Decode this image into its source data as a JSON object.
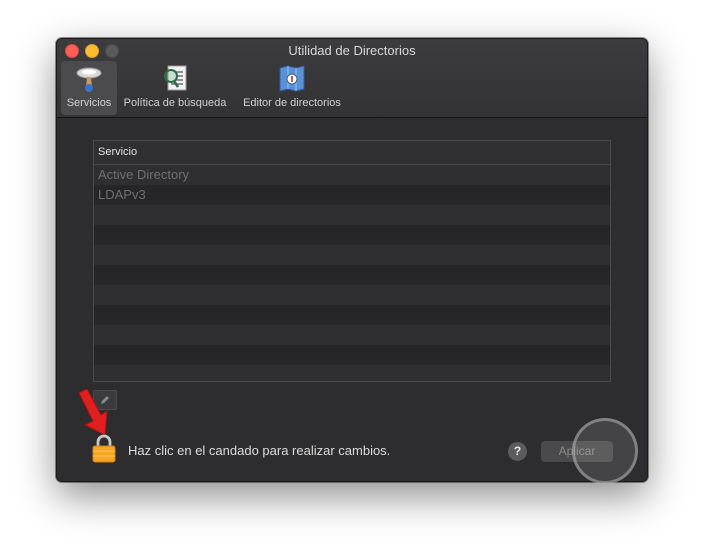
{
  "window": {
    "title": "Utilidad de Directorios"
  },
  "toolbar": {
    "items": [
      {
        "label": "Servicios",
        "icon": "services-icon"
      },
      {
        "label": "Política de búsqueda",
        "icon": "search-policy-icon"
      },
      {
        "label": "Editor de directorios",
        "icon": "directory-editor-icon"
      }
    ]
  },
  "services": {
    "header": "Servicio",
    "rows": [
      "Active Directory",
      "LDAPv3"
    ]
  },
  "footer": {
    "lock_text": "Haz clic en el candado para realizar cambios.",
    "help_label": "?",
    "apply_label": "Aplicar"
  },
  "colors": {
    "window_bg": "#2d2d2f",
    "close": "#fe5f57",
    "minimize": "#febc2e",
    "lock": "#f6a623",
    "arrow": "#e02020"
  }
}
